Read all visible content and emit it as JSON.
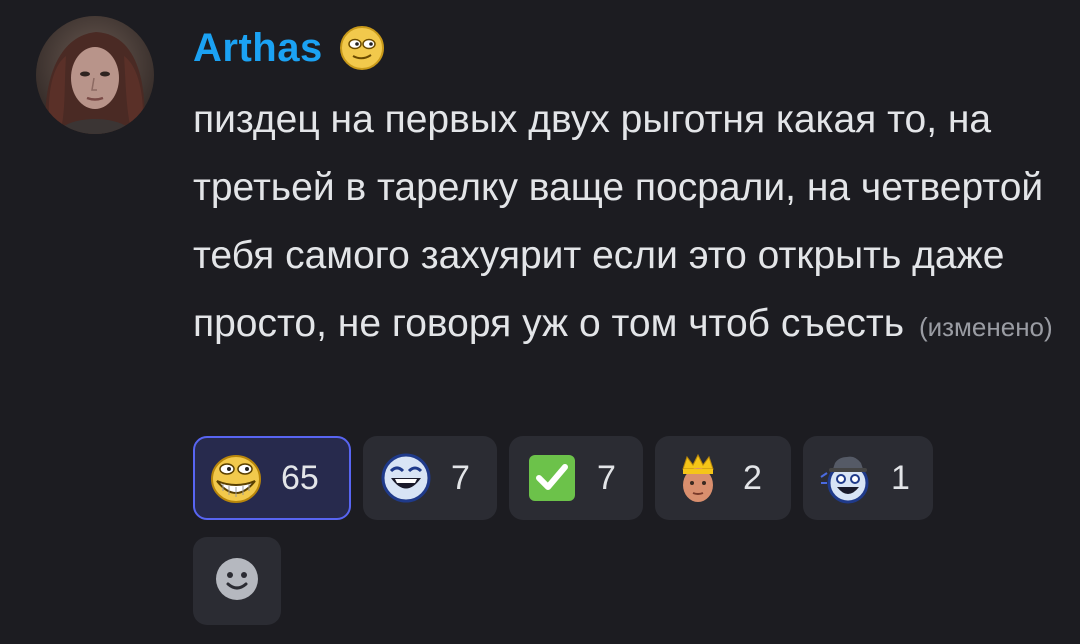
{
  "message": {
    "author": "Arthas",
    "author_color": "#1ba2f3",
    "role_icon": "meme-face-icon",
    "text": "пиздец на первых двух рыготня какая то, на третьей в тарелку ваще посрали, на четвертой тебя самого захуярит если это открыть даже просто, не говоря уж о том чтоб съесть",
    "edited_label": "(изменено)"
  },
  "reactions": [
    {
      "emoji": "grinning-troll-face-icon",
      "count": "65",
      "active": true
    },
    {
      "emoji": "laughing-blue-face-icon",
      "count": "7",
      "active": false
    },
    {
      "emoji": "green-check-icon",
      "count": "7",
      "active": false
    },
    {
      "emoji": "crowned-man-icon",
      "count": "2",
      "active": false
    },
    {
      "emoji": "hat-laughing-face-icon",
      "count": "1",
      "active": false
    }
  ],
  "add_reaction": {
    "icon": "smiley-add-reaction-icon"
  },
  "colors": {
    "background": "#1c1c21",
    "reaction_bg": "#2b2c33",
    "active_reaction_bg": "#272a4d",
    "active_reaction_border": "#5865f2"
  }
}
